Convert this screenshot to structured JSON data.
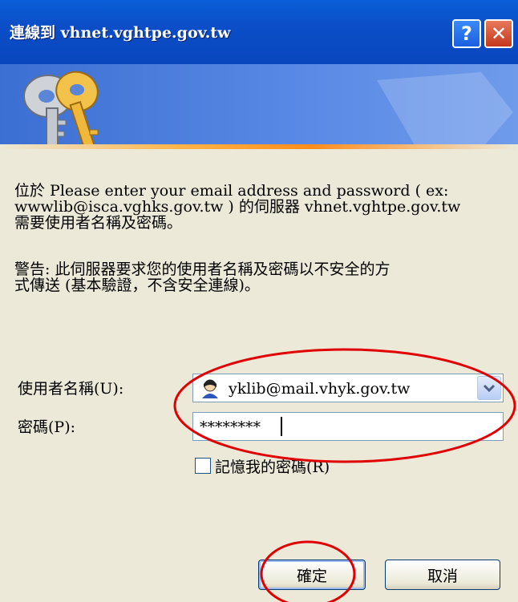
{
  "dialog": {
    "title": "連線到 vhnet.vghtpe.gov.tw",
    "help_label": "?",
    "close_label": "✕"
  },
  "message": {
    "line1": "位於 Please enter your email address and password ( ex:",
    "line2": "wwwlib@isca.vghks.gov.tw ) 的伺服器 vhnet.vghtpe.gov.tw",
    "line3": "需要使用者名稱及密碼。",
    "warning1": "警告: 此伺服器要求您的使用者名稱及密碼以不安全的方",
    "warning2": "式傳送 (基本驗證，不含安全連線)。"
  },
  "form": {
    "username_label": "使用者名稱(U):",
    "username_value": "yklib@mail.vhyk.gov.tw",
    "password_label": "密碼(P):",
    "password_value": "********",
    "remember_label": "記憶我的密碼(R)",
    "remember_checked": false
  },
  "buttons": {
    "ok_label": "確定",
    "cancel_label": "取消"
  },
  "colors": {
    "titlebar": "#0b4ec7",
    "annotation": "#e00000",
    "face": "#ece9d8"
  }
}
